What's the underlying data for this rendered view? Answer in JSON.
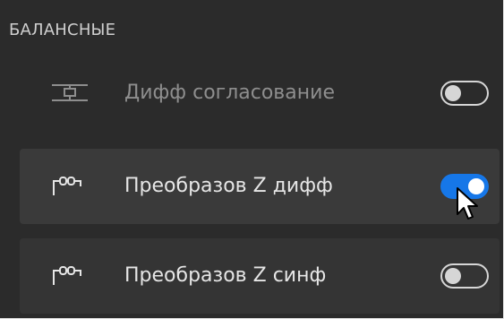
{
  "section": {
    "title": "БАЛАНСНЫЕ"
  },
  "rows": [
    {
      "label": "Дифф согласование",
      "icon": "balanced-matching-icon",
      "enabled": false
    },
    {
      "label": "Преобразов Z дифф",
      "icon": "z-transform-diff-icon",
      "enabled": true
    },
    {
      "label": "Преобразов Z синф",
      "icon": "z-transform-common-icon",
      "enabled": false
    }
  ],
  "colors": {
    "panel_bg": "#2b2b2b",
    "row_highlight": "#3a3a3a",
    "toggle_on": "#1677e8",
    "text_primary": "#e6e6e6",
    "text_muted": "#8e8e8e"
  },
  "cursor": {
    "icon": "mouse-pointer-icon"
  }
}
